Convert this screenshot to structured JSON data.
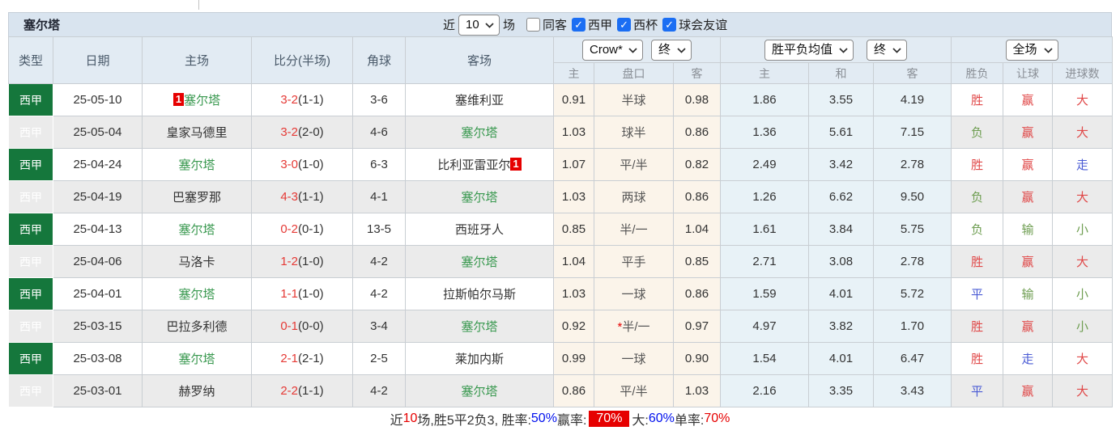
{
  "colors": {
    "league_green": "#15773c",
    "celta_green": "#3a9950",
    "score_red": "#e53935",
    "result_red": "#e04848",
    "result_green": "#6f9e52",
    "result_blue": "#4a5bd4",
    "accent_red": "#e60000",
    "link_blue": "#0010ee",
    "row_alt": "#ebebeb",
    "handicap_bg": "#fbf4ea",
    "avg_bg": "#e8f2f7",
    "header_bg": "#d9e4ef",
    "thead_bg": "#e2ebf3"
  },
  "top_bar": {
    "title": "塞尔塔",
    "recent_label": "近",
    "recent_value": "10",
    "matches_label": "场",
    "checkboxes": [
      {
        "label": "同客",
        "checked": false
      },
      {
        "label": "西甲",
        "checked": true
      },
      {
        "label": "西杯",
        "checked": true
      },
      {
        "label": "球会友谊",
        "checked": true
      }
    ]
  },
  "table": {
    "columns": [
      "类型",
      "日期",
      "主场",
      "比分(半场)",
      "角球",
      "客场"
    ],
    "selects": {
      "company": "Crow*",
      "company_time": "终",
      "avg": "胜平负均值",
      "avg_time": "终",
      "scope": "全场"
    },
    "sub_columns": [
      "主",
      "盘口",
      "客",
      "主",
      "和",
      "客",
      "胜负",
      "让球",
      "进球数"
    ],
    "rows": [
      {
        "league": "西甲",
        "date": "25-05-10",
        "home": {
          "name": "塞尔塔",
          "celta": true,
          "badge": "1"
        },
        "score": "3-2",
        "half": "(1-1)",
        "corners": "3-6",
        "away": {
          "name": "塞维利亚",
          "celta": false
        },
        "handicap": {
          "home": "0.91",
          "line": "半球",
          "star": false,
          "away": "0.98"
        },
        "avg": {
          "home": "1.86",
          "draw": "3.55",
          "away": "4.19"
        },
        "results": [
          {
            "text": "胜",
            "color": "red"
          },
          {
            "text": "赢",
            "color": "red"
          },
          {
            "text": "大",
            "color": "red"
          }
        ]
      },
      {
        "league": "西甲",
        "date": "25-05-04",
        "home": {
          "name": "皇家马德里",
          "celta": false
        },
        "score": "3-2",
        "half": "(2-0)",
        "corners": "4-6",
        "away": {
          "name": "塞尔塔",
          "celta": true
        },
        "handicap": {
          "home": "1.03",
          "line": "球半",
          "star": false,
          "away": "0.86"
        },
        "avg": {
          "home": "1.36",
          "draw": "5.61",
          "away": "7.15"
        },
        "results": [
          {
            "text": "负",
            "color": "green"
          },
          {
            "text": "赢",
            "color": "red"
          },
          {
            "text": "大",
            "color": "red"
          }
        ]
      },
      {
        "league": "西甲",
        "date": "25-04-24",
        "home": {
          "name": "塞尔塔",
          "celta": true
        },
        "score": "3-0",
        "half": "(1-0)",
        "corners": "6-3",
        "away": {
          "name": "比利亚雷亚尔",
          "celta": false,
          "badge": "1"
        },
        "handicap": {
          "home": "1.07",
          "line": "平/半",
          "star": false,
          "away": "0.82"
        },
        "avg": {
          "home": "2.49",
          "draw": "3.42",
          "away": "2.78"
        },
        "results": [
          {
            "text": "胜",
            "color": "red"
          },
          {
            "text": "赢",
            "color": "red"
          },
          {
            "text": "走",
            "color": "blue"
          }
        ]
      },
      {
        "league": "西甲",
        "date": "25-04-19",
        "home": {
          "name": "巴塞罗那",
          "celta": false
        },
        "score": "4-3",
        "half": "(1-1)",
        "corners": "4-1",
        "away": {
          "name": "塞尔塔",
          "celta": true
        },
        "handicap": {
          "home": "1.03",
          "line": "两球",
          "star": false,
          "away": "0.86"
        },
        "avg": {
          "home": "1.26",
          "draw": "6.62",
          "away": "9.50"
        },
        "results": [
          {
            "text": "负",
            "color": "green"
          },
          {
            "text": "赢",
            "color": "red"
          },
          {
            "text": "大",
            "color": "red"
          }
        ]
      },
      {
        "league": "西甲",
        "date": "25-04-13",
        "home": {
          "name": "塞尔塔",
          "celta": true
        },
        "score": "0-2",
        "half": "(0-1)",
        "corners": "13-5",
        "away": {
          "name": "西班牙人",
          "celta": false
        },
        "handicap": {
          "home": "0.85",
          "line": "半/一",
          "star": false,
          "away": "1.04"
        },
        "avg": {
          "home": "1.61",
          "draw": "3.84",
          "away": "5.75"
        },
        "results": [
          {
            "text": "负",
            "color": "green"
          },
          {
            "text": "输",
            "color": "green"
          },
          {
            "text": "小",
            "color": "green"
          }
        ]
      },
      {
        "league": "西甲",
        "date": "25-04-06",
        "home": {
          "name": "马洛卡",
          "celta": false
        },
        "score": "1-2",
        "half": "(1-0)",
        "corners": "4-2",
        "away": {
          "name": "塞尔塔",
          "celta": true
        },
        "handicap": {
          "home": "1.04",
          "line": "平手",
          "star": false,
          "away": "0.85"
        },
        "avg": {
          "home": "2.71",
          "draw": "3.08",
          "away": "2.78"
        },
        "results": [
          {
            "text": "胜",
            "color": "red"
          },
          {
            "text": "赢",
            "color": "red"
          },
          {
            "text": "大",
            "color": "red"
          }
        ]
      },
      {
        "league": "西甲",
        "date": "25-04-01",
        "home": {
          "name": "塞尔塔",
          "celta": true
        },
        "score": "1-1",
        "half": "(1-0)",
        "corners": "4-2",
        "away": {
          "name": "拉斯帕尔马斯",
          "celta": false
        },
        "handicap": {
          "home": "1.03",
          "line": "一球",
          "star": false,
          "away": "0.86"
        },
        "avg": {
          "home": "1.59",
          "draw": "4.01",
          "away": "5.72"
        },
        "results": [
          {
            "text": "平",
            "color": "blue"
          },
          {
            "text": "输",
            "color": "green"
          },
          {
            "text": "小",
            "color": "green"
          }
        ]
      },
      {
        "league": "西甲",
        "date": "25-03-15",
        "home": {
          "name": "巴拉多利德",
          "celta": false
        },
        "score": "0-1",
        "half": "(0-0)",
        "corners": "3-4",
        "away": {
          "name": "塞尔塔",
          "celta": true
        },
        "handicap": {
          "home": "0.92",
          "line": "半/一",
          "star": true,
          "away": "0.97"
        },
        "avg": {
          "home": "4.97",
          "draw": "3.82",
          "away": "1.70"
        },
        "results": [
          {
            "text": "胜",
            "color": "red"
          },
          {
            "text": "赢",
            "color": "red"
          },
          {
            "text": "小",
            "color": "green"
          }
        ]
      },
      {
        "league": "西甲",
        "date": "25-03-08",
        "home": {
          "name": "塞尔塔",
          "celta": true
        },
        "score": "2-1",
        "half": "(2-1)",
        "corners": "2-5",
        "away": {
          "name": "莱加内斯",
          "celta": false
        },
        "handicap": {
          "home": "0.99",
          "line": "一球",
          "star": false,
          "away": "0.90"
        },
        "avg": {
          "home": "1.54",
          "draw": "4.01",
          "away": "6.47"
        },
        "results": [
          {
            "text": "胜",
            "color": "red"
          },
          {
            "text": "走",
            "color": "blue"
          },
          {
            "text": "大",
            "color": "red"
          }
        ]
      },
      {
        "league": "西甲",
        "date": "25-03-01",
        "home": {
          "name": "赫罗纳",
          "celta": false
        },
        "score": "2-2",
        "half": "(1-1)",
        "corners": "4-2",
        "away": {
          "name": "塞尔塔",
          "celta": true
        },
        "handicap": {
          "home": "0.86",
          "line": "平/半",
          "star": false,
          "away": "1.03"
        },
        "avg": {
          "home": "2.16",
          "draw": "3.35",
          "away": "3.43"
        },
        "results": [
          {
            "text": "平",
            "color": "blue"
          },
          {
            "text": "赢",
            "color": "red"
          },
          {
            "text": "大",
            "color": "red"
          }
        ]
      }
    ]
  },
  "footer": {
    "segments": [
      {
        "text": "近",
        "color": "black"
      },
      {
        "text": "10",
        "color": "red"
      },
      {
        "text": "场,胜5平2负3, 胜率:",
        "color": "black"
      },
      {
        "text": "50%",
        "color": "blue"
      },
      {
        "text": " 赢率:",
        "color": "black"
      },
      {
        "text": "70%",
        "color": "redbox"
      },
      {
        "text": " 大:",
        "color": "black"
      },
      {
        "text": "60%",
        "color": "blue"
      },
      {
        "text": " 单率:",
        "color": "black"
      },
      {
        "text": "70%",
        "color": "red"
      }
    ]
  }
}
